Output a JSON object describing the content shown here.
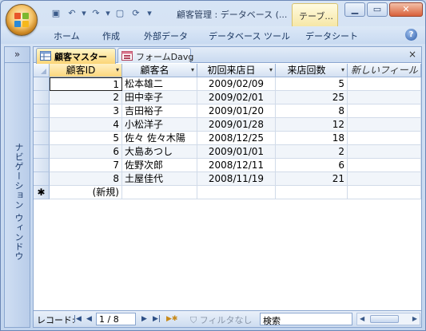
{
  "title": {
    "text": "顧客管理 : データベース (...",
    "context_tab": "テーブ..."
  },
  "ribbon": {
    "tabs": [
      "ホーム",
      "作成",
      "外部データ",
      "データベース ツール",
      "データシート"
    ],
    "help": "?"
  },
  "nav_pane": {
    "toggle": "»",
    "label": "ナビゲーション ウィンドウ"
  },
  "doc_tabs": [
    {
      "label": "顧客マスター",
      "active": true
    },
    {
      "label": "フォームDavg",
      "active": false
    }
  ],
  "doc_close": "×",
  "grid": {
    "columns": [
      {
        "label": "顧客ID",
        "arrow": "▾"
      },
      {
        "label": "顧客名",
        "arrow": "▾"
      },
      {
        "label": "初回来店日",
        "arrow": "▾"
      },
      {
        "label": "来店回数",
        "arrow": "▾"
      },
      {
        "label": "新しいフィールド",
        "arrow": ""
      }
    ],
    "rows": [
      {
        "id": "1",
        "name": "松本雄二",
        "date": "2009/02/09",
        "visits": "5"
      },
      {
        "id": "2",
        "name": "田中幸子",
        "date": "2009/02/01",
        "visits": "25"
      },
      {
        "id": "3",
        "name": "吉田裕子",
        "date": "2009/01/20",
        "visits": "8"
      },
      {
        "id": "4",
        "name": "小松洋子",
        "date": "2009/01/28",
        "visits": "12"
      },
      {
        "id": "5",
        "name": "佐々 佐々木陽",
        "date": "2008/12/25",
        "visits": "18"
      },
      {
        "id": "6",
        "name": "大島あつし",
        "date": "2009/01/01",
        "visits": "2"
      },
      {
        "id": "7",
        "name": "佐野次郎",
        "date": "2008/12/11",
        "visits": "6"
      },
      {
        "id": "8",
        "name": "土屋佳代",
        "date": "2008/11/19",
        "visits": "21"
      }
    ],
    "new_row_marker": "✱",
    "new_row_label": "(新規)"
  },
  "record_nav": {
    "label": "レコード:",
    "position": "1 / 8",
    "filter": "フィルタなし",
    "search": "検索"
  }
}
